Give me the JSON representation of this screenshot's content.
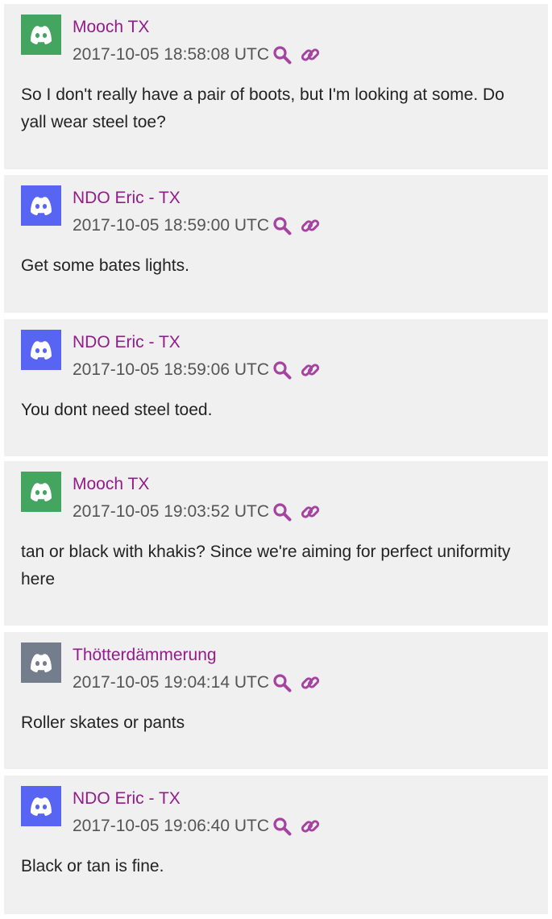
{
  "messages": [
    {
      "author": "Mooch TX",
      "avatar_color": "#43a55f",
      "avatar_icon": "discord-logo-icon",
      "timestamp": "2017-10-05 18:58:08 UTC",
      "text": "So I don't really have a pair of boots, but I'm looking at some. Do yall wear steel toe?"
    },
    {
      "author": "NDO Eric - TX",
      "avatar_color": "#5865f2",
      "avatar_icon": "discord-logo-icon",
      "timestamp": "2017-10-05 18:59:00 UTC",
      "text": "Get some bates lights."
    },
    {
      "author": "NDO Eric - TX",
      "avatar_color": "#5865f2",
      "avatar_icon": "discord-logo-icon",
      "timestamp": "2017-10-05 18:59:06 UTC",
      "text": "You dont need steel toed."
    },
    {
      "author": "Mooch TX",
      "avatar_color": "#43a55f",
      "avatar_icon": "discord-logo-icon",
      "timestamp": "2017-10-05 19:03:52 UTC",
      "text": "tan or black with khakis? Since we're aiming for perfect uniformity here"
    },
    {
      "author": "Thötterdämmerung",
      "avatar_color": "#737d8c",
      "avatar_icon": "discord-logo-icon",
      "timestamp": "2017-10-05 19:04:14 UTC",
      "text": "Roller skates or pants"
    },
    {
      "author": "NDO Eric - TX",
      "avatar_color": "#5865f2",
      "avatar_icon": "discord-logo-icon",
      "timestamp": "2017-10-05 19:06:40 UTC",
      "text": "Black or tan is fine."
    }
  ],
  "colors": {
    "card_background": "#f0f0f0",
    "author_link": "#921c8a",
    "icon_accent": "#a544a0",
    "timestamp_text": "#555555",
    "body_text": "#222222"
  },
  "icons": {
    "search": "search-icon",
    "permalink": "link-icon"
  }
}
